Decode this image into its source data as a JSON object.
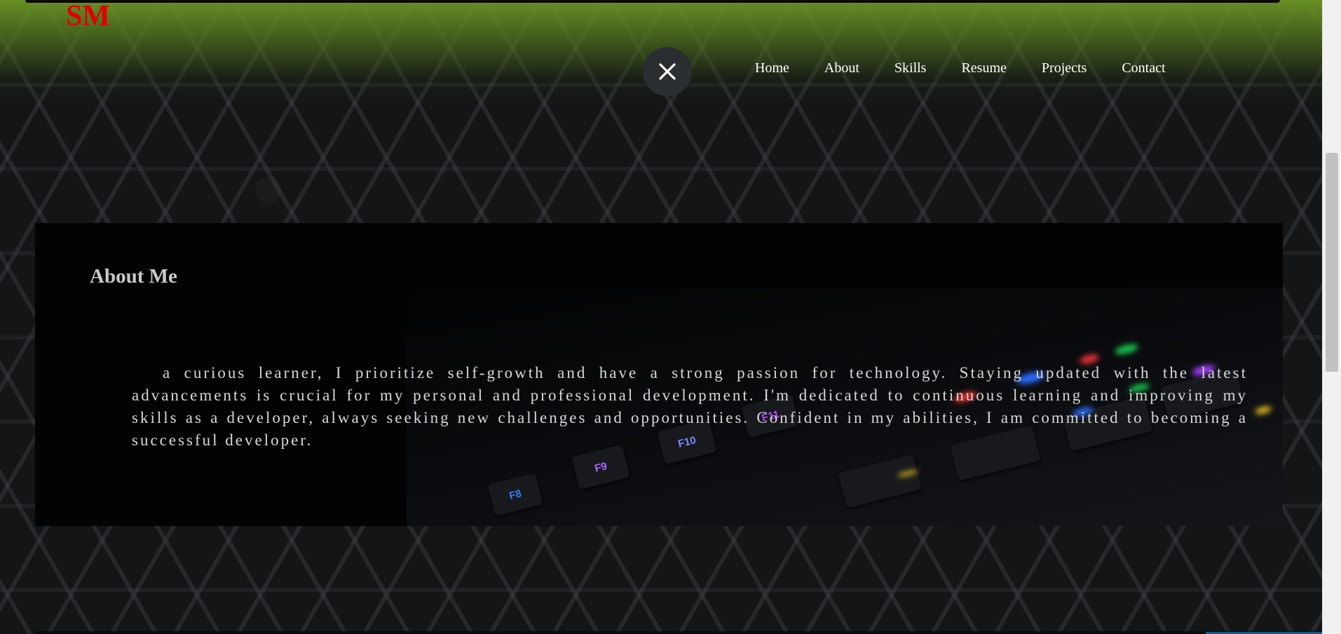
{
  "logo": "SM",
  "nav": {
    "items": [
      "Home",
      "About",
      "Skills",
      "Resume",
      "Projects",
      "Contact"
    ]
  },
  "menu_toggle": {
    "icon": "close-icon"
  },
  "about": {
    "title": "About Me",
    "text": "a curious learner, I prioritize self-growth and have a strong passion for technology. Staying updated with the latest advancements is crucial for my personal and professional development. I'm dedicated to continuous learning and improving my skills as a developer, always seeking new challenges and opportunities. Confident in my abilities, I am committed to becoming a successful developer."
  },
  "keyboard_keys": [
    "F8",
    "F9",
    "F10",
    "F11"
  ],
  "colors": {
    "logo": "#e00000",
    "header_green": "#6c9624",
    "panel": "#030303",
    "nav_text": "#ffffff"
  }
}
